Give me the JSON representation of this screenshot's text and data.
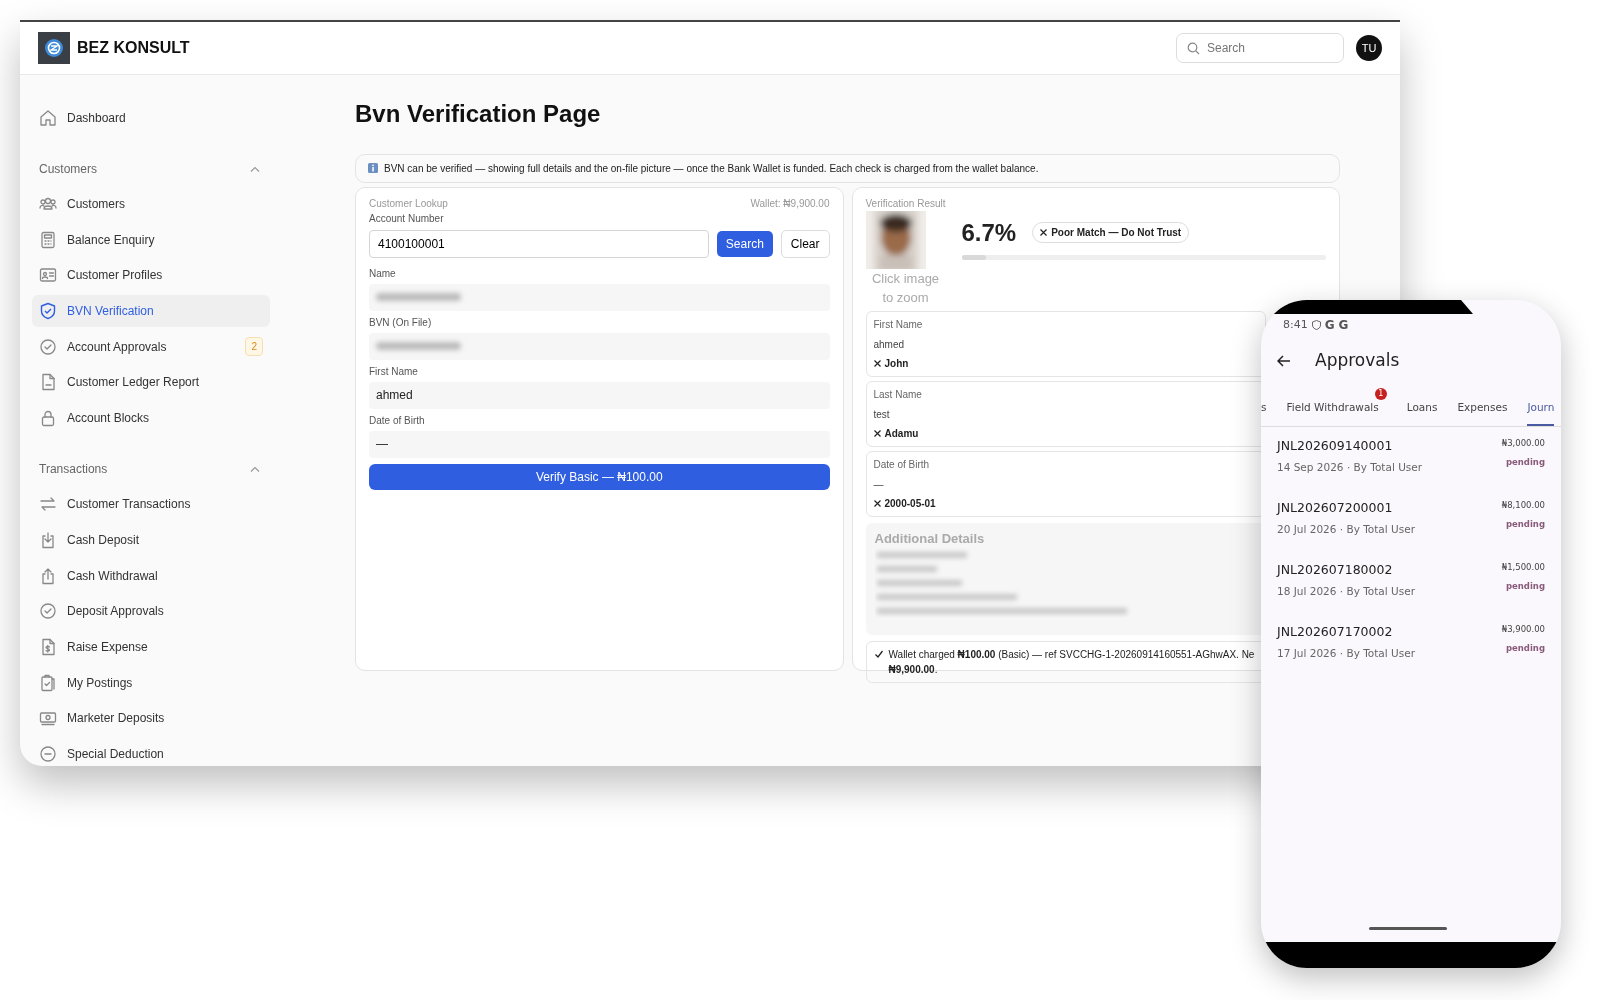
{
  "app": {
    "brand": "BEZ KONSULT",
    "search_placeholder": "Search",
    "avatar": "TU"
  },
  "sidebar": {
    "top": [
      {
        "label": "Dashboard",
        "selected": false
      }
    ],
    "sections": [
      {
        "title": "Customers",
        "expanded": true,
        "items": [
          {
            "label": "Customers",
            "selected": false
          },
          {
            "label": "Balance Enquiry",
            "selected": false
          },
          {
            "label": "Customer Profiles",
            "selected": false
          },
          {
            "label": "BVN Verification",
            "selected": true
          },
          {
            "label": "Account Approvals",
            "selected": false,
            "badge": "2"
          },
          {
            "label": "Customer Ledger Report",
            "selected": false
          },
          {
            "label": "Account Blocks",
            "selected": false
          }
        ]
      },
      {
        "title": "Transactions",
        "expanded": true,
        "items": [
          {
            "label": "Customer Transactions",
            "selected": false
          },
          {
            "label": "Cash Deposit",
            "selected": false
          },
          {
            "label": "Cash Withdrawal",
            "selected": false
          },
          {
            "label": "Deposit Approvals",
            "selected": false
          },
          {
            "label": "Raise Expense",
            "selected": false
          },
          {
            "label": "My Postings",
            "selected": false
          },
          {
            "label": "Marketer Deposits",
            "selected": false
          },
          {
            "label": "Special Deduction",
            "selected": false
          }
        ]
      }
    ]
  },
  "page": {
    "title": "Bvn Verification Page",
    "notice": "BVN can be verified — showing full details and the on-file picture — once the Bank Wallet is funded. Each check is charged from the wallet balance.",
    "lookup": {
      "title": "Customer Lookup",
      "wallet": "Wallet: ₦9,900.00",
      "account_label": "Account Number",
      "account_value": "4100100001",
      "search_button": "Search",
      "clear_button": "Clear",
      "fields": [
        {
          "label": "Name",
          "blurred": true
        },
        {
          "label": "BVN (On File)",
          "blurred": true
        },
        {
          "label": "First Name",
          "value": "ahmed"
        },
        {
          "label": "Date of Birth",
          "value": "—"
        }
      ],
      "verify_button": "Verify Basic — ₦100.00"
    },
    "result": {
      "title": "Verification Result",
      "photo": {
        "kind": "picture"
      },
      "photo_hint": "Click image to zoom",
      "score": "6.7%",
      "level": 0.067,
      "verdict": "Poor Match — Do Not Trust",
      "comparisons": [
        {
          "label": "First Name",
          "on_file": "ahmed",
          "bvn": "John",
          "match": false
        },
        {
          "label": "Last Name",
          "on_file": "test",
          "bvn": "Adamu",
          "match": false
        },
        {
          "label": "Date of Birth",
          "on_file": "—",
          "bvn": "2000-05-01",
          "match": false
        }
      ],
      "additional": {
        "title": "Additional Details",
        "blurred": true
      },
      "charge_lines": [
        "Wallet charged **₦100.00** (Basic) — ref SVCCHG-1-20260914160551-AGhwAX. Ne",
        "**₦9,900.00**."
      ]
    }
  },
  "phone": {
    "time": "8:41",
    "status_icons": [
      "G",
      "G"
    ],
    "title": "Approvals",
    "tabs": [
      {
        "label": "s",
        "selected": false
      },
      {
        "label": "Field Withdrawals",
        "selected": false,
        "badge": "1"
      },
      {
        "label": "Loans",
        "selected": false
      },
      {
        "label": "Expenses",
        "selected": false
      },
      {
        "label": "Journ",
        "selected": true
      }
    ],
    "items": [
      {
        "ref": "JNL202609140001",
        "meta": "14 Sep 2026 · By Total User",
        "amount": "₦3,000.00",
        "status": "pending"
      },
      {
        "ref": "JNL202607200001",
        "meta": "20 Jul 2026 · By Total User",
        "amount": "₦8,100.00",
        "status": "pending"
      },
      {
        "ref": "JNL202607180002",
        "meta": "18 Jul 2026 · By Total User",
        "amount": "₦1,500.00",
        "status": "pending"
      },
      {
        "ref": "JNL202607170002",
        "meta": "17 Jul 2026 · By Total User",
        "amount": "₦3,900.00",
        "status": "pending"
      }
    ]
  }
}
